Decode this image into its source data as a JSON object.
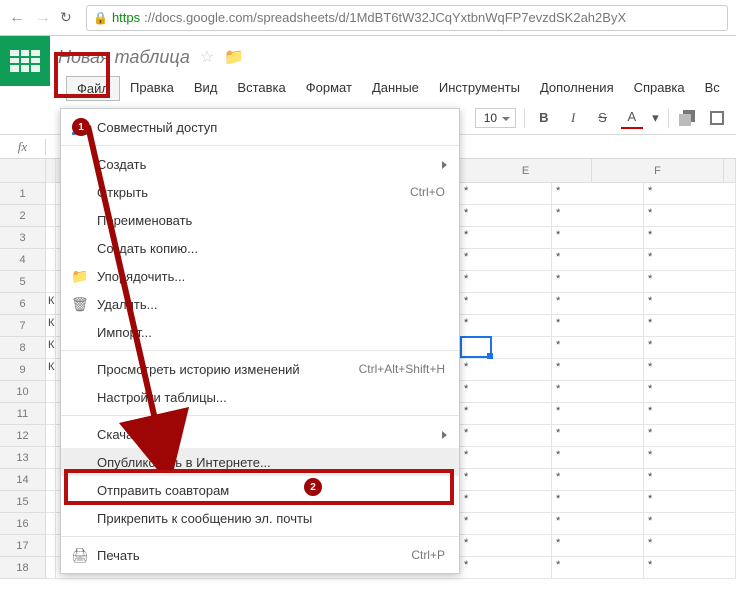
{
  "browser": {
    "url_secure": "https",
    "url_rest": "://docs.google.com/spreadsheets/d/1MdBT6tW32JCqYxtbnWqFP7evzdSK2ah2ByX"
  },
  "doc": {
    "title": "Новая таблица"
  },
  "menu": {
    "file": "Файл",
    "edit": "Правка",
    "view": "Вид",
    "insert": "Вставка",
    "format": "Формат",
    "data": "Данные",
    "tools": "Инструменты",
    "addons": "Дополнения",
    "help": "Справка",
    "more": "Вс"
  },
  "toolbar": {
    "font_size": "10",
    "bold": "B",
    "italic": "I",
    "strike": "S",
    "textcolor": "A"
  },
  "fx": {
    "label": "fx"
  },
  "columns": {
    "e": "E",
    "f": "F"
  },
  "rows": [
    "1",
    "2",
    "3",
    "4",
    "5",
    "6",
    "7",
    "8",
    "9",
    "10",
    "11",
    "12",
    "13",
    "14",
    "15",
    "16",
    "17",
    "18"
  ],
  "strip_chars": [
    "",
    "",
    "",
    "",
    "",
    "К",
    "К",
    "К",
    "К",
    "",
    "",
    "",
    "",
    "",
    "",
    "",
    "",
    ""
  ],
  "cell_star": "*",
  "dropdown": {
    "share": "Совместный доступ",
    "create": "Создать",
    "open": "Открыть",
    "open_sc": "Ctrl+O",
    "rename": "Переименовать",
    "copy": "Создать копию...",
    "organize": "Упорядочить...",
    "delete": "Удалить...",
    "import": "Импорт...",
    "history": "Просмотреть историю изменений",
    "history_sc": "Ctrl+Alt+Shift+H",
    "settings": "Настройки таблицы...",
    "download": "Скачать как",
    "publish": "Опубликовать в Интернете...",
    "email_collab": "Отправить соавторам",
    "attach": "Прикрепить к сообщению эл. почты",
    "print": "Печать",
    "print_sc": "Ctrl+P"
  },
  "markers": {
    "one": "1",
    "two": "2"
  }
}
